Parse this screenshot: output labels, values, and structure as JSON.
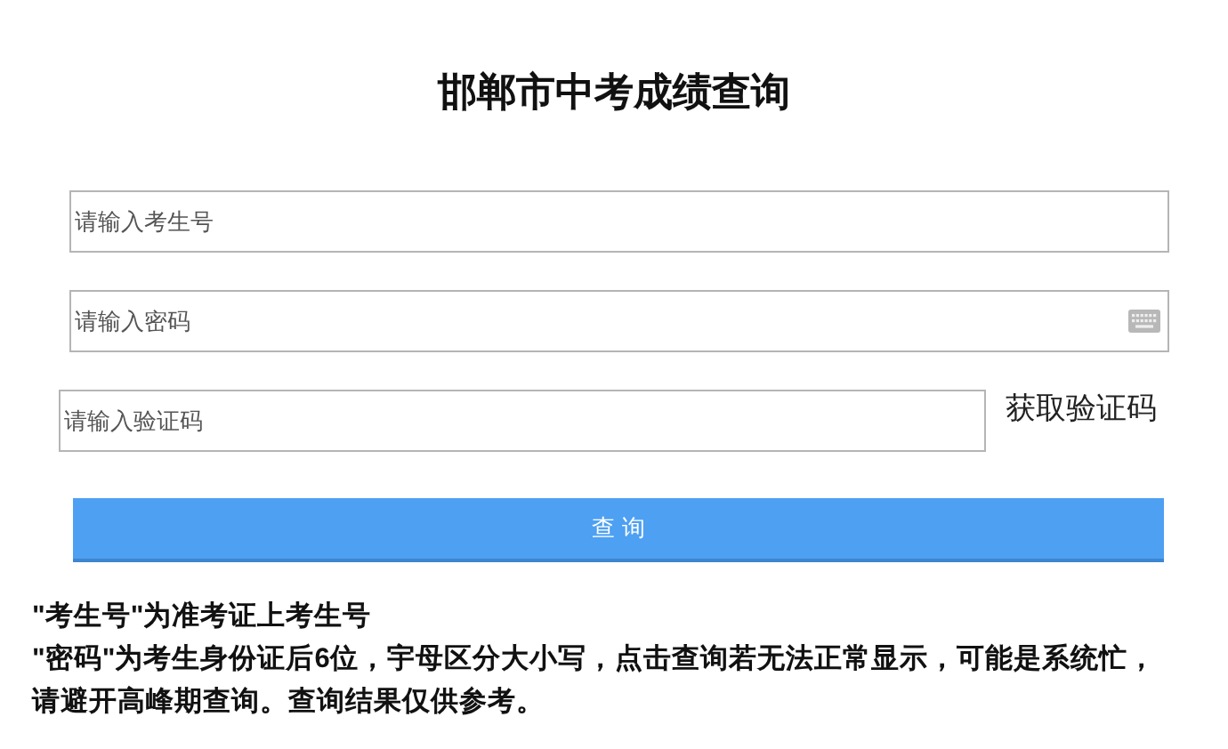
{
  "title": "邯郸市中考成绩查询",
  "fields": [
    {
      "placeholder": "请输入考生号",
      "kind": "text"
    },
    {
      "placeholder": "请输入密码",
      "kind": "password"
    },
    {
      "placeholder": "请输入验证码",
      "kind": "captcha"
    }
  ],
  "captcha_link": "获取验证码",
  "submit_button": "查 询",
  "notes": [
    "\"考生号\"为准考证上考生号",
    "\"密码\"为考生身份证后6位，宇母区分大小写，点击查询若无法正常显示，可能是系统忙，请避开高峰期查询。查询结果仅供参考。"
  ]
}
